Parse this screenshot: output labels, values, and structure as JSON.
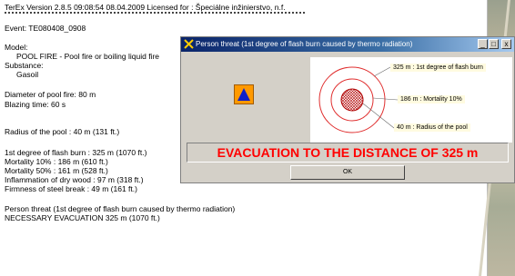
{
  "report": {
    "header": "TerEx  Version 2.8.5       09:08:54  08.04.2009    Licensed for : Špeciálne inžinierstvo, n.f.",
    "event": "Event:   TE080408_0908",
    "model_label": "Model:",
    "model_value": "POOL FIRE - Pool fire or boiling liquid fire",
    "substance_label": "Substance:",
    "substance_value": "Gasoil",
    "diameter": "Diameter of pool fire:   80 m",
    "blazing": "Blazing time:   60 s",
    "radius_pool": "Radius of the pool :    40 m (131 ft.)",
    "flash_burn": "1st degree of flash burn :   325 m (1070 ft.)",
    "mortality10": "Mortality 10% :    186 m (610 ft.)",
    "mortality50": "Mortality 50% :    161 m (528 ft.)",
    "inflammation": "Inflammation of dry wood :    97 m (318 ft.)",
    "firmness": "Firmness of steel break :    49 m (161 ft.)",
    "person_threat": "Person threat (1st degree of flash burn caused by thermo radiation)",
    "necessary": "NECESSARY EVACUATION     325 m (1070 ft.)"
  },
  "dialog": {
    "title": "Person threat (1st degree of flash burn caused by thermo radiation)",
    "minimize": "_",
    "restore": "□",
    "close": "x",
    "label_flash": "325 m : 1st degree of flash burn",
    "label_mortality": "186 m : Mortality 10%",
    "label_pool": "40 m : Radius of the pool",
    "evacuation": "EVACUATION TO THE DISTANCE OF   325 m",
    "ok": "OK"
  }
}
